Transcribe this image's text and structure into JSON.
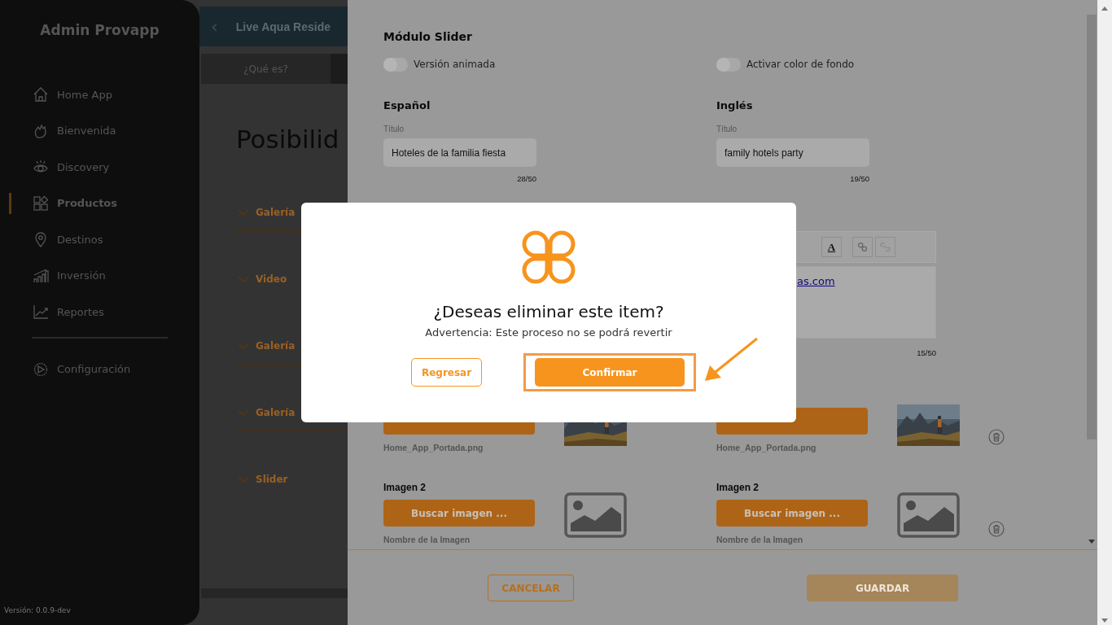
{
  "sidebar": {
    "title": "Admin Provapp",
    "items": [
      {
        "label": "Home App",
        "selected": false
      },
      {
        "label": "Bienvenida",
        "selected": false
      },
      {
        "label": "Discovery",
        "selected": false
      },
      {
        "label": "Productos",
        "selected": true
      },
      {
        "label": "Destinos",
        "selected": false
      },
      {
        "label": "Inversión",
        "selected": false
      },
      {
        "label": "Reportes",
        "selected": false
      }
    ],
    "settings": {
      "label": "Configuración",
      "selected": false
    },
    "version": "Versión: 0.0.9-dev"
  },
  "header": {
    "back": "‹",
    "title": "Live Aqua Reside"
  },
  "tabs": [
    {
      "label": "¿Qué es?",
      "selected": false
    }
  ],
  "page_title": "Posibilid",
  "sections": [
    {
      "label": "Galería"
    },
    {
      "label": "Video"
    },
    {
      "label": "Galería"
    },
    {
      "label": "Galería"
    },
    {
      "label": "Slider"
    }
  ],
  "drawer": {
    "module_title": "Módulo Slider",
    "toggles": [
      {
        "label": "Versión animada",
        "on": false
      },
      {
        "label": "Activar color de fondo",
        "on": false
      }
    ],
    "columns": [
      {
        "heading": "Español",
        "title_label": "Título",
        "title_value": "Hoteles de la familia fiesta",
        "title_count": "28/50",
        "images": [
          {
            "filename": "Home_App_Portada.png",
            "deletable": false
          },
          {
            "label": "Imagen 2",
            "button": "Buscar imagen ...",
            "kind": "empty",
            "filename": "Nombre de la Imagen",
            "deletable": false
          }
        ]
      },
      {
        "heading": "Inglés",
        "title_label": "Título",
        "title_value": "family hotels party",
        "title_count": "19/50",
        "editor": {
          "tools": [
            {
              "kind": "text-color",
              "glyph": "A"
            },
            {
              "kind": "link"
            },
            {
              "kind": "unlink"
            }
          ],
          "text": "as.com",
          "count": "15/50"
        },
        "images": [
          {
            "filename": "Home_App_Portada.png",
            "deletable": true
          },
          {
            "label": "Imagen 2",
            "button": "Buscar imagen ...",
            "kind": "empty",
            "filename": "Nombre de la Imagen",
            "deletable": true
          }
        ]
      }
    ],
    "cancel": "CANCELAR",
    "save": {
      "label": "GUARDAR",
      "disabled": true
    }
  },
  "dialog": {
    "title": "¿Deseas eliminar este item?",
    "message": "Advertencia: Este proceso no se podrá revertir",
    "buttons": [
      {
        "label": "Regresar",
        "kind": "secondary",
        "highlighted": false
      },
      {
        "label": "Confirmar",
        "kind": "primary",
        "highlighted": true
      }
    ]
  }
}
